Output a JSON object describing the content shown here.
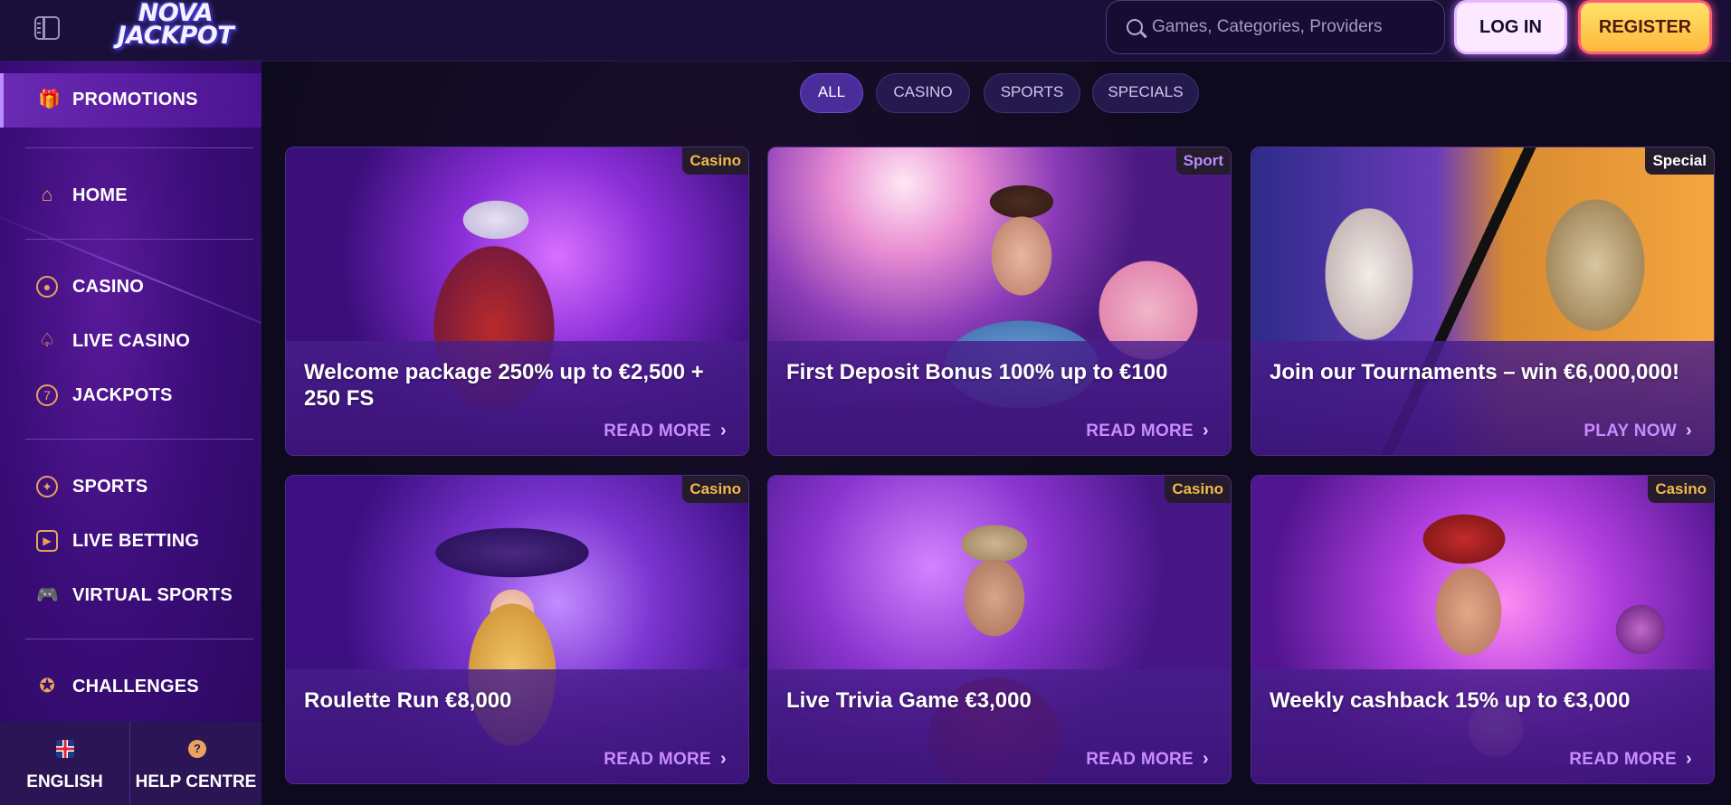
{
  "header": {
    "logo_line1": "NOVA",
    "logo_line2": "JACKPOT",
    "search_placeholder": "Games, Categories, Providers",
    "login_label": "LOG IN",
    "register_label": "REGISTER"
  },
  "sidebar": {
    "promotions_label": "PROMOTIONS",
    "items": [
      {
        "label": "HOME",
        "icon": "home-icon"
      },
      {
        "label": "CASINO",
        "icon": "casino-chip-icon"
      },
      {
        "label": "LIVE CASINO",
        "icon": "spade-icon"
      },
      {
        "label": "JACKPOTS",
        "icon": "seven-icon",
        "glyph": "7"
      },
      {
        "label": "SPORTS",
        "icon": "soccer-ball-icon"
      },
      {
        "label": "LIVE BETTING",
        "icon": "play-icon"
      },
      {
        "label": "VIRTUAL SPORTS",
        "icon": "gamepad-icon"
      },
      {
        "label": "CHALLENGES",
        "icon": "medal-icon"
      }
    ],
    "footer": {
      "language_label": "ENGLISH",
      "help_label": "HELP CENTRE",
      "help_glyph": "?"
    }
  },
  "filters": [
    {
      "label": "ALL",
      "active": true
    },
    {
      "label": "CASINO",
      "active": false
    },
    {
      "label": "SPORTS",
      "active": false
    },
    {
      "label": "SPECIALS",
      "active": false
    }
  ],
  "promotions": [
    {
      "tag": "Casino",
      "tag_color": "#f2b84a",
      "title": "Welcome package 250% up to €2,500 + 250 FS",
      "cta": "READ MORE"
    },
    {
      "tag": "Sport",
      "tag_color": "#b98cff",
      "title": "First Deposit Bonus 100% up to €100",
      "cta": "READ MORE"
    },
    {
      "tag": "Special",
      "tag_color": "#ffffff",
      "title": "Join our Tournaments – win €6,000,000!",
      "cta": "PLAY NOW"
    },
    {
      "tag": "Casino",
      "tag_color": "#f2b84a",
      "title": "Roulette Run €8,000",
      "cta": "READ MORE"
    },
    {
      "tag": "Casino",
      "tag_color": "#f2b84a",
      "title": "Live Trivia Game €3,000",
      "cta": "READ MORE"
    },
    {
      "tag": "Casino",
      "tag_color": "#f2b84a",
      "title": "Weekly cashback 15% up to €3,000",
      "cta": "READ MORE"
    }
  ],
  "colors": {
    "accent_purple": "#c98cff",
    "accent_gold": "#f2b84a",
    "sidebar_icon": "#e8a35e"
  }
}
